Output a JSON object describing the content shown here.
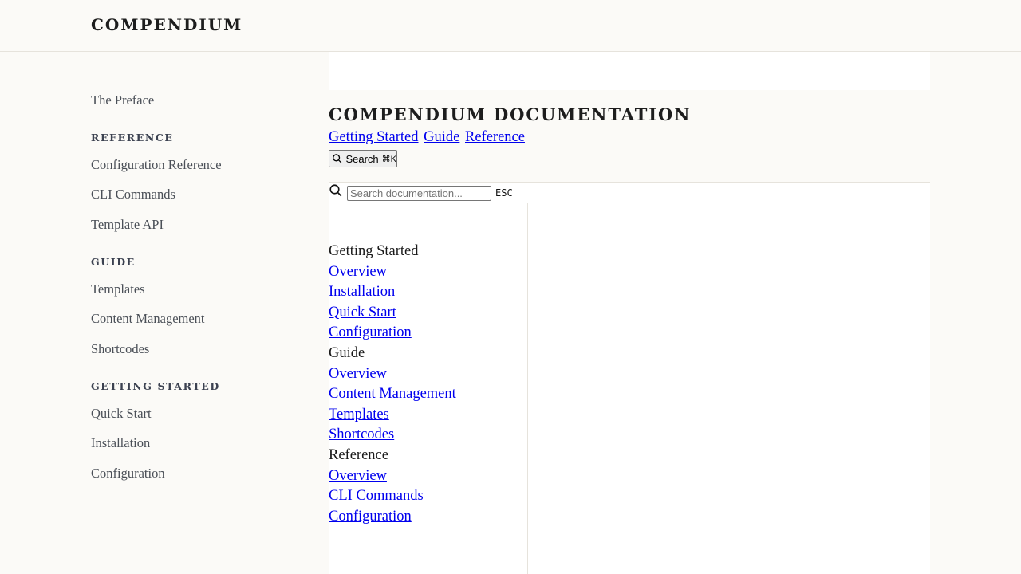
{
  "brand": "COMPENDIUM",
  "sidebar": {
    "preface": "The Preface",
    "sections": [
      {
        "heading": "REFERENCE",
        "items": [
          "Configuration Reference",
          "CLI Commands",
          "Template API"
        ]
      },
      {
        "heading": "GUIDE",
        "items": [
          "Templates",
          "Content Management",
          "Shortcodes"
        ]
      },
      {
        "heading": "GETTING STARTED",
        "items": [
          "Quick Start",
          "Installation",
          "Configuration"
        ]
      }
    ]
  },
  "header": {
    "title": "COMPENDIUM DOCUMENTATION",
    "nav": [
      "Getting Started",
      "Guide",
      "Reference"
    ],
    "search_button": {
      "label": "Search",
      "shortcut": "⌘K"
    }
  },
  "search": {
    "placeholder": "Search documentation...",
    "esc": "ESC"
  },
  "tree": [
    {
      "section": "Getting Started",
      "links": [
        "Overview",
        "Installation",
        "Quick Start",
        "Configuration"
      ]
    },
    {
      "section": "Guide",
      "links": [
        "Overview",
        "Content Management",
        "Templates",
        "Shortcodes"
      ]
    },
    {
      "section": "Reference",
      "links": [
        "Overview",
        "CLI Commands",
        "Configuration"
      ]
    }
  ],
  "icons": {
    "search": "search-icon"
  }
}
